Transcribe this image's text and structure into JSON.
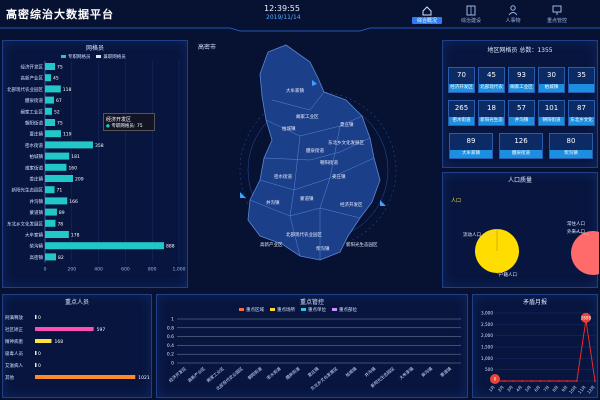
{
  "header": {
    "title": "高密综治大数据平台",
    "time": "12:39:55",
    "date": "2019/11/14",
    "nav": [
      {
        "label": "综合概况",
        "icon": "home-icon",
        "active": true
      },
      {
        "label": "综治建设",
        "icon": "building-icon",
        "active": false
      },
      {
        "label": "人事物",
        "icon": "people-icon",
        "active": false
      },
      {
        "label": "重点管控",
        "icon": "monitor-icon",
        "active": false
      }
    ]
  },
  "grid_panel": {
    "title": "网格员",
    "legend": [
      "专职网格员",
      "兼职网格员"
    ],
    "tooltip": {
      "title": "经济开发区",
      "label": "专职网格员",
      "value": 75
    },
    "x_ticks": [
      "0",
      "200",
      "400",
      "600",
      "800",
      "1,000"
    ],
    "chart_data": {
      "type": "bar",
      "categories": [
        "经济开发区",
        "高新产业区",
        "北部现代农业园区",
        "醴泉街道",
        "阚家工业区",
        "朝阳街道",
        "夏庄镇",
        "密水街道",
        "柏城镇",
        "咸家街道",
        "姜庄镇",
        "新阳光生态园区",
        "井沟镇",
        "蒙道镇",
        "东北乡文化发展区",
        "大牟家镇",
        "柴沟镇",
        "高密镇"
      ],
      "series": [
        {
          "name": "专职网格员",
          "values": [
            75,
            45,
            118,
            67,
            52,
            75,
            119,
            358,
            181,
            160,
            209,
            71,
            166,
            89,
            78,
            178,
            888,
            82
          ]
        }
      ],
      "xlim": [
        0,
        1000
      ]
    }
  },
  "map": {
    "title": "高密市",
    "regions": [
      "大牟家镇",
      "阚家工业区",
      "柏城镇",
      "夏庄镇",
      "东北乡文化发展区",
      "醴泉街道",
      "朝阳街道",
      "密水街道",
      "姜庄镇",
      "井沟镇",
      "蒙道镇",
      "经济开发区",
      "北部现代农业园区",
      "高新产业区",
      "柴沟镇",
      "新阳光生态园区"
    ]
  },
  "stats_panel": {
    "title": "地区网格员 总数：1355",
    "cells": [
      {
        "num": "70",
        "name": "经济开发区"
      },
      {
        "num": "45",
        "name": "北部现代农业园区"
      },
      {
        "num": "93",
        "name": "阚家工业区"
      },
      {
        "num": "30",
        "name": "柏城镇"
      },
      {
        "num": "35",
        "name": ""
      },
      {
        "num": "265",
        "name": "密水街道"
      },
      {
        "num": "18",
        "name": "新阳光生态园区"
      },
      {
        "num": "57",
        "name": "井沟镇"
      },
      {
        "num": "101",
        "name": "朝阳街道"
      },
      {
        "num": "87",
        "name": "东北乡文化"
      },
      {
        "num": "89",
        "name": "大牟家镇"
      },
      {
        "num": "126",
        "name": "醴泉街道"
      },
      {
        "num": "80",
        "name": "柴沟镇"
      }
    ]
  },
  "population_panel": {
    "title": "人口质量",
    "subtitle": "人口",
    "pie1": {
      "labels": [
        "流动人口",
        "户籍人口"
      ],
      "color": "#ffdd00"
    },
    "pie2": {
      "labels": [
        "常住人口",
        "外来人口"
      ],
      "color": "#ff6b6b"
    }
  },
  "persons_panel": {
    "title": "重点人员",
    "chart_data": {
      "type": "bar",
      "categories": [
        "刑满释放",
        "社区矫正",
        "精神病患",
        "吸毒人员",
        "艾滋病人",
        "其他"
      ],
      "values": [
        0,
        597,
        168,
        0,
        0,
        1021
      ],
      "colors": [
        "#e5e5e5",
        "#ff4fb0",
        "#ffe23c",
        "#e5e5e5",
        "#e5e5e5",
        "#ff8a2a"
      ],
      "xlim": [
        0,
        1100
      ]
    }
  },
  "control_panel": {
    "title": "重点管控",
    "legend": [
      {
        "name": "重点区域",
        "color": "#ff6a3d"
      },
      {
        "name": "重点场所",
        "color": "#ffd33a"
      },
      {
        "name": "重点单位",
        "color": "#2fc5e8"
      },
      {
        "name": "重点部位",
        "color": "#c890ff"
      }
    ],
    "chart_data": {
      "type": "line",
      "categories": [
        "经济开发区",
        "高新产业区",
        "阚家工业区",
        "北部现代农业园区",
        "朝阳街道",
        "密水街道",
        "醴泉街道",
        "夏庄镇",
        "东北乡文化发展区",
        "柏城镇",
        "井沟镇",
        "新阳光生态园区",
        "大牟家镇",
        "柴沟镇",
        "蒙道镇"
      ],
      "y_ticks": [
        "0",
        "0.2",
        "0.4",
        "0.6",
        "0.8",
        "1"
      ],
      "ylim": [
        0,
        1
      ]
    }
  },
  "conflict_panel": {
    "title": "矛盾月报",
    "y_ticks": [
      "0",
      "500",
      "1,000",
      "1,500",
      "2,000",
      "2,500",
      "3,000"
    ],
    "chart_data": {
      "type": "line",
      "categories": [
        "1月",
        "2月",
        "3月",
        "4月",
        "5月",
        "6月",
        "7月",
        "8月",
        "9月",
        "10月",
        "11月",
        "12月"
      ],
      "values": [
        0,
        0,
        0,
        0,
        0,
        0,
        0,
        0,
        0,
        0,
        2698,
        0
      ],
      "labeled_points": [
        {
          "index": 0,
          "label": "0"
        },
        {
          "index": 10,
          "label": "2698"
        }
      ],
      "ylim": [
        0,
        3000
      ]
    }
  }
}
